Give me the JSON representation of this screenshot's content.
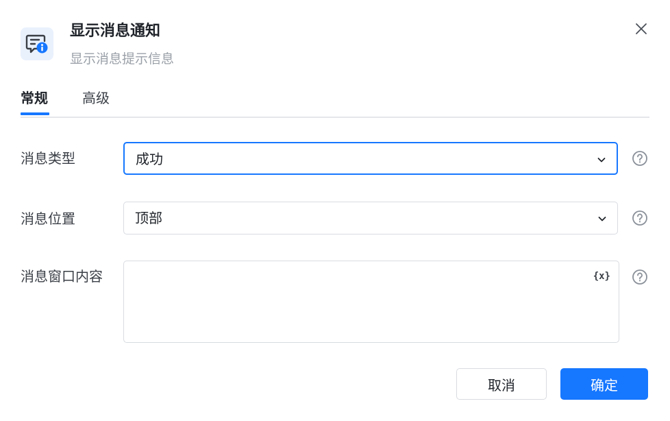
{
  "header": {
    "title": "显示消息通知",
    "subtitle": "显示消息提示信息",
    "icon": "message-info-icon",
    "accent_color": "#1677ff"
  },
  "tabs": [
    {
      "label": "常规",
      "active": true
    },
    {
      "label": "高级",
      "active": false
    }
  ],
  "fields": {
    "message_type": {
      "label": "消息类型",
      "value": "成功"
    },
    "message_position": {
      "label": "消息位置",
      "value": "顶部"
    },
    "message_content": {
      "label": "消息窗口内容",
      "value": "",
      "variable_button": "{x}"
    }
  },
  "footer": {
    "cancel_label": "取消",
    "confirm_label": "确定"
  }
}
